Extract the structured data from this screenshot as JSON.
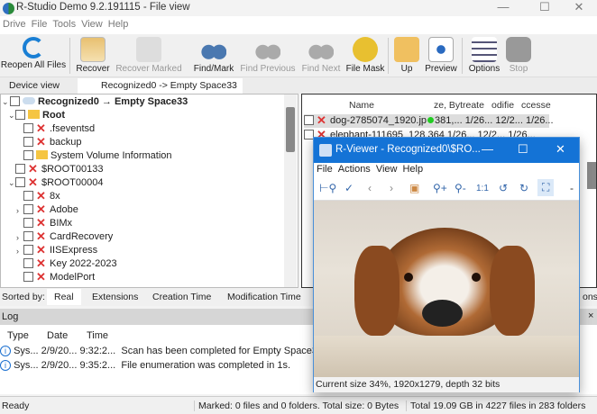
{
  "window": {
    "title": "R-Studio Demo 9.2.191115 - File view"
  },
  "menu": [
    "Drive",
    "File",
    "Tools",
    "View",
    "Help"
  ],
  "toolbar": [
    {
      "label": "Reopen All Files",
      "enabled": true
    },
    {
      "label": "Recover",
      "enabled": true
    },
    {
      "label": "Recover Marked",
      "enabled": false
    },
    {
      "label": "Find/Mark",
      "enabled": true
    },
    {
      "label": "Find Previous",
      "enabled": false
    },
    {
      "label": "Find Next",
      "enabled": false
    },
    {
      "label": "File Mask",
      "enabled": true
    },
    {
      "label": "Up",
      "enabled": true
    },
    {
      "label": "Preview",
      "enabled": true
    },
    {
      "label": "Options",
      "enabled": true
    },
    {
      "label": "Stop",
      "enabled": false
    }
  ],
  "tabs": [
    {
      "label": "Device view"
    },
    {
      "label": "Recognized0 -> Empty Space33"
    }
  ],
  "tree": [
    {
      "label": "Recognized0 → Empty Space33"
    },
    {
      "label": "Root"
    },
    {
      "label": ".fseventsd"
    },
    {
      "label": "backup"
    },
    {
      "label": "System Volume Information"
    },
    {
      "label": "$ROOT00133"
    },
    {
      "label": "$ROOT00004"
    },
    {
      "label": "8x"
    },
    {
      "label": "Adobe"
    },
    {
      "label": "BIMx"
    },
    {
      "label": "CardRecovery"
    },
    {
      "label": "IISExpress"
    },
    {
      "label": "Key 2022-2023"
    },
    {
      "label": "ModelPort"
    }
  ],
  "list": {
    "headers": [
      "Name",
      "ze, Byt",
      "reate",
      "odifie",
      "ccesse"
    ],
    "rows": [
      [
        "dog-2785074_1920.jp",
        "381,...",
        "1/26...",
        "12/2...",
        "1/26..."
      ],
      [
        "elephant-111695_128",
        "364",
        "1/26...",
        "12/2...",
        "1/26..."
      ]
    ]
  },
  "sortbar": {
    "label": "Sorted by:",
    "tabs": [
      "Real",
      "Extensions",
      "Creation Time",
      "Modification Time"
    ],
    "tail": "ons"
  },
  "log": {
    "title": "Log",
    "close": "×",
    "headers": [
      "Type",
      "Date",
      "Time"
    ],
    "rows": [
      [
        "Sys...",
        "2/9/20...",
        "9:32:2...",
        "Scan has been completed for Empty Space33"
      ],
      [
        "Sys...",
        "2/9/20...",
        "9:35:2...",
        "File enumeration was completed in 1s."
      ]
    ]
  },
  "status": {
    "left": "Ready",
    "middle": "Marked: 0 files and 0 folders. Total size: 0 Bytes",
    "right": "Total 19.09 GB in 4227 files in 283 folders"
  },
  "viewer": {
    "title": "R-Viewer - Recognized0\\$RO...",
    "menu": [
      "File",
      "Actions",
      "View",
      "Help"
    ],
    "tools": [
      "⊢⚲",
      "✓",
      "‹",
      "›",
      "▣",
      "⚲+",
      "⚲-",
      "1:1",
      "↺",
      "↻",
      "⛶",
      "-"
    ],
    "status": "Current size 34%, 1920x1279, depth 32 bits"
  }
}
